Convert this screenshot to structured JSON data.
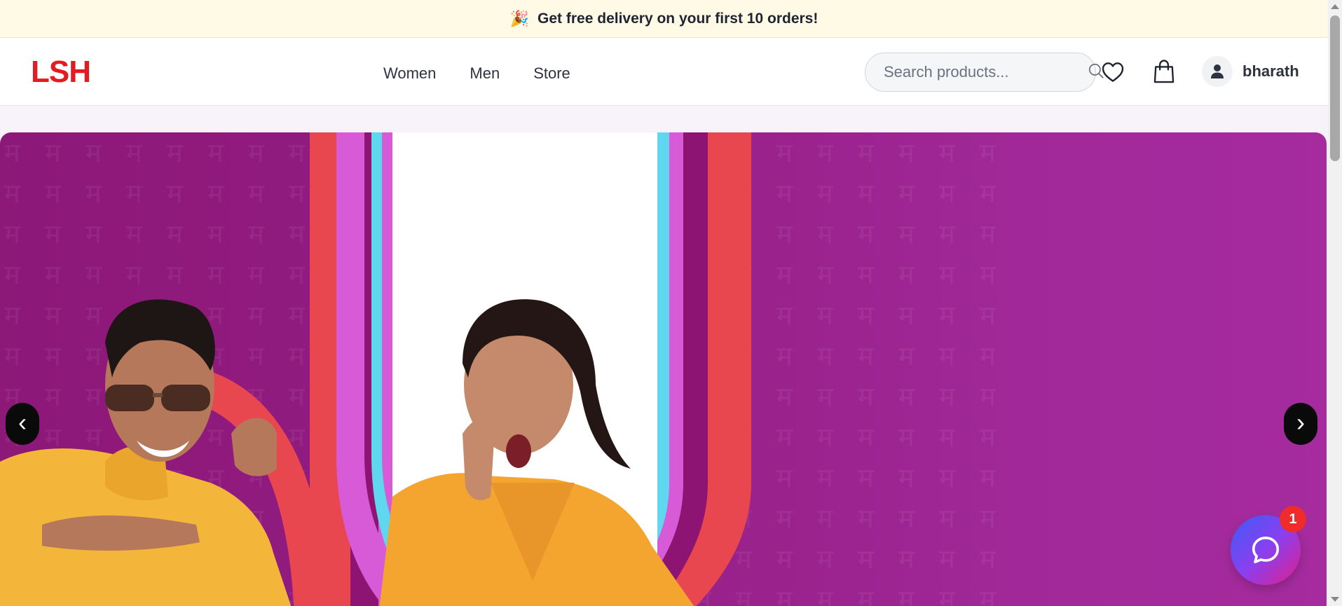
{
  "promo": {
    "icon": "party-popper-icon",
    "text": "Get free delivery on your first 10 orders!"
  },
  "header": {
    "logo": "LSH",
    "nav": [
      {
        "label": "Women"
      },
      {
        "label": "Men"
      },
      {
        "label": "Store"
      }
    ],
    "search": {
      "placeholder": "Search products...",
      "value": ""
    },
    "user": {
      "name": "bharath"
    },
    "accent_color": "#e31b23"
  },
  "hero": {
    "prev_label": "‹",
    "next_label": "›",
    "background_color": "#951e85"
  },
  "chat": {
    "badge": "1"
  }
}
